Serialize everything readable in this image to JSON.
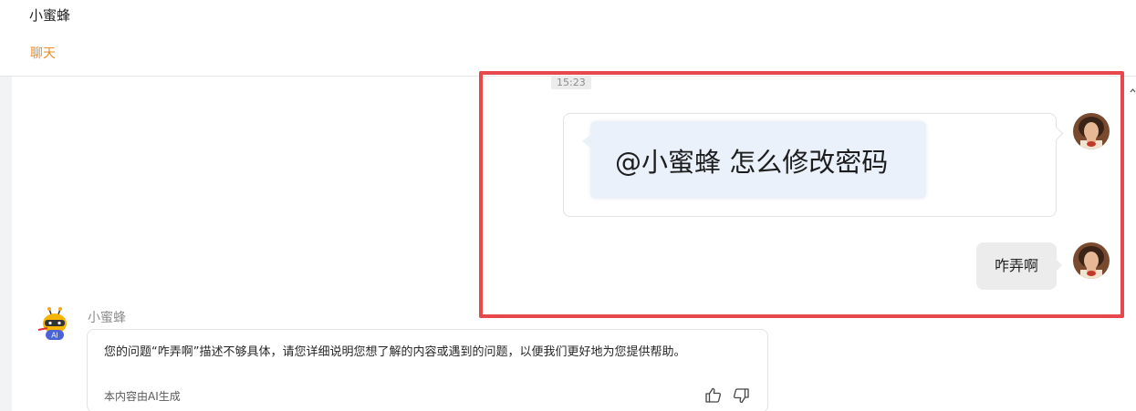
{
  "header": {
    "title": "小蜜蜂",
    "tab_chat": "聊天"
  },
  "messages": {
    "timestamp": "15:23",
    "image_message_text": "@小蜜蜂 怎么修改密码",
    "text_message": "咋弄啊"
  },
  "bot": {
    "name": "小蜜蜂",
    "badge": "AI",
    "reply": "您的问题“咋弄啊”描述不够具体，请您详细说明您想了解的内容或遇到的问题，以便我们更好地为您提供帮助。",
    "ai_note": "本内容由AI生成"
  },
  "colors": {
    "accent": "#f08a24",
    "highlight_frame": "#e8484b"
  }
}
